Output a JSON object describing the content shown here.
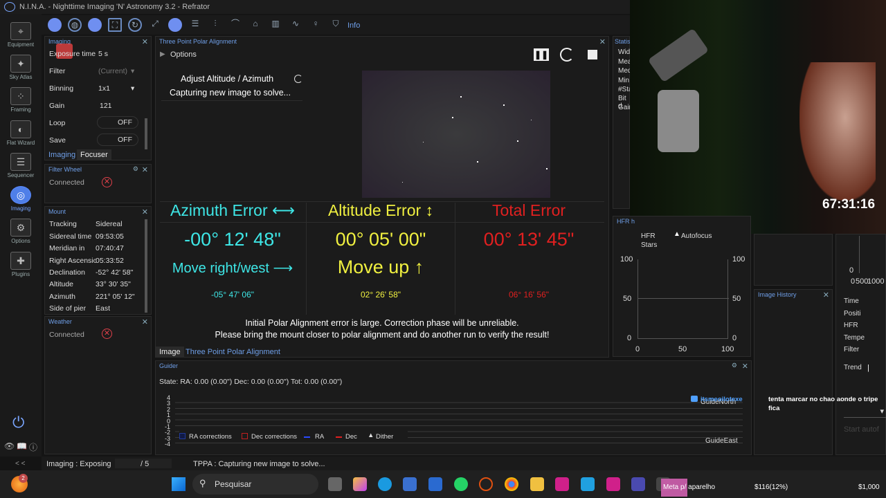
{
  "window": {
    "title": "N.I.N.A. - Nighttime Imaging 'N' Astronomy 3.2  -  Refrator"
  },
  "nav": [
    {
      "label": "Equipment",
      "icon": "camera-icon"
    },
    {
      "label": "Sky Atlas",
      "icon": "sky-atlas-icon"
    },
    {
      "label": "Framing",
      "icon": "framing-icon"
    },
    {
      "label": "Flat Wizard",
      "icon": "flat-wizard-icon"
    },
    {
      "label": "Sequencer",
      "icon": "sequencer-icon"
    },
    {
      "label": "Imaging",
      "icon": "imaging-icon"
    },
    {
      "label": "Options",
      "icon": "gear-icon"
    },
    {
      "label": "Plugins",
      "icon": "puzzle-icon"
    }
  ],
  "toolbar": {
    "info_label": "Info"
  },
  "imaging": {
    "header": "Imaging",
    "rows": [
      {
        "label": "Exposure time",
        "value": "5  s"
      },
      {
        "label": "Filter",
        "value": "(Current)"
      },
      {
        "label": "Binning",
        "value": "1x1"
      },
      {
        "label": "Gain",
        "value": "121"
      },
      {
        "label": "Loop",
        "value": "OFF"
      },
      {
        "label": "Save",
        "value": "OFF"
      }
    ],
    "tabs": [
      "Imaging",
      "Focuser"
    ]
  },
  "filterwheel": {
    "header": "Filter Wheel",
    "status": "Connected"
  },
  "mount": {
    "header": "Mount",
    "rows": [
      {
        "label": "Tracking",
        "value": "Sidereal"
      },
      {
        "label": "Sidereal time",
        "value": "09:53:05"
      },
      {
        "label": "Meridian in",
        "value": "07:40:47"
      },
      {
        "label": "Right Ascension",
        "value": "05:33:52"
      },
      {
        "label": "Declination",
        "value": "-52° 42' 58\""
      },
      {
        "label": "Altitude",
        "value": "33° 30' 35\""
      },
      {
        "label": "Azimuth",
        "value": "221° 05' 12\""
      },
      {
        "label": "Side of pier",
        "value": "East"
      }
    ]
  },
  "weather": {
    "header": "Weather",
    "status": "Connected"
  },
  "tppa": {
    "header": "Three Point Polar Alignment",
    "options": "Options",
    "step_title": "Adjust Altitude / Azimuth",
    "step_status": "Capturing new image to solve...",
    "azimuth": {
      "label": "Azimuth Error ⟷",
      "value": "-00° 12' 48\"",
      "hint": "Move right/west ⟶",
      "total": "-05° 47' 06\""
    },
    "altitude": {
      "label": "Altitude Error ↕",
      "value": "00° 05' 00\"",
      "hint": "Move up ↑",
      "total": "02° 26' 58\""
    },
    "total": {
      "label": "Total Error",
      "value": "00° 13' 45\"",
      "total": "06° 16' 56\""
    },
    "warning1": "Initial Polar Alignment error is large. Correction phase will be unreliable.",
    "warning2": "Please bring the mount closer to polar alignment and do another run to verify the result!",
    "tabs": [
      "Image",
      "Three Point Polar Alignment"
    ],
    "colors": {
      "azimuth": "#3ee6e6",
      "altitude": "#f0f040",
      "total": "#e02020"
    }
  },
  "stats": {
    "header": "Statist",
    "rows": [
      "Wid",
      "Mea",
      "Med",
      "Min",
      "#Sta",
      "Bit d",
      "Gain"
    ]
  },
  "hfr": {
    "header": "HFR h",
    "legend": [
      "HFR",
      "Autofocus",
      "Stars"
    ],
    "y": [
      "100",
      "50",
      "0"
    ],
    "y2": [
      "100",
      "50",
      "0"
    ],
    "x": [
      "0",
      "50",
      "100"
    ]
  },
  "history": {
    "header": "Image History"
  },
  "autofocus": {
    "rows": [
      "Time",
      "Positi",
      "HFR",
      "Tempe",
      "Filter",
      "Trend"
    ],
    "ticks": [
      "0",
      "0",
      "500",
      "1000"
    ],
    "button": "Start autof"
  },
  "guider": {
    "header": "Guider",
    "state": "State:  RA: 0.00 (0.00\")  Dec: 0.00 (0.00\")  Tot: 0.00 (0.00\")",
    "y": [
      "4",
      "3",
      "2",
      "1",
      "0",
      "-1",
      "-2",
      "-3",
      "-4"
    ],
    "north": "GuideNorth",
    "east": "GuideEast",
    "legend": [
      "RA corrections",
      "Dec corrections",
      "RA",
      "Dec",
      "Dither"
    ]
  },
  "status": {
    "imaging": "Imaging :   Exposing",
    "progress": "/ 5",
    "tppa": "TPPA :   Capturing new image to solve...",
    "collapse": "< <"
  },
  "overlay": {
    "timer": "67:31:16",
    "chat_user": "itsmeoilotexe",
    "chat_msg": "tenta marcar no chao aonde o tripe fica",
    "meta": "Meta p/ aparelho",
    "goal": "$116(12%)",
    "goal_total": "$1,000"
  },
  "taskbar": {
    "search": "Pesquisar",
    "badge": "2"
  }
}
